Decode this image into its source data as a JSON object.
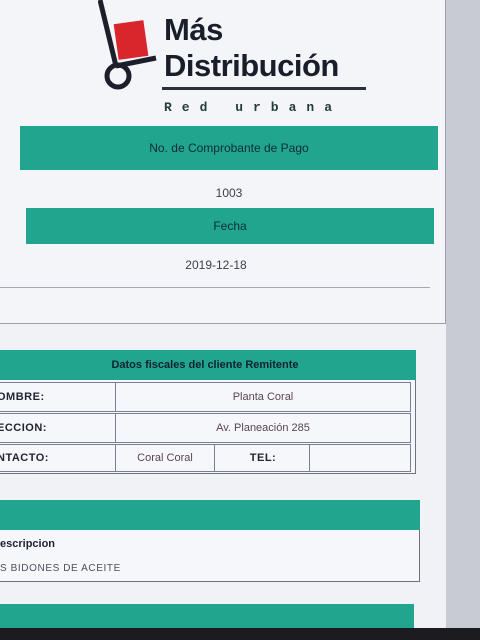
{
  "logo": {
    "line1": "Más",
    "line2": "Distribución",
    "tagline": "Red urbana",
    "icon": "hand-truck-logo-icon"
  },
  "receipt": {
    "number_label": "No. de Comprobante de Pago",
    "number_value": "1003",
    "date_label": "Fecha",
    "date_value": "2019-12-18"
  },
  "sender": {
    "header": "Datos fiscales del cliente Remitente",
    "name_label": "OMBRE:",
    "name_value": "Planta Coral",
    "address_label": "ECCION:",
    "address_value": "Av. Planeación 285",
    "contact_label": "NTACTO:",
    "contact_value": "Coral Coral",
    "phone_label": "TEL:",
    "phone_value": ""
  },
  "items": {
    "description_label": "escripcion",
    "description_value": "S BIDONES DE ACEITE"
  },
  "colors": {
    "accent": "#22a58f",
    "logo_red": "#d8262c"
  }
}
